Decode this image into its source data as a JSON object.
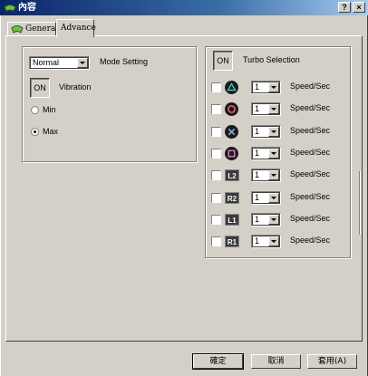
{
  "window": {
    "title": "內容",
    "help_button": "?",
    "close_button": "×"
  },
  "tabs": [
    {
      "label": "General",
      "active": false
    },
    {
      "label": "Advance",
      "active": true
    }
  ],
  "mode": {
    "combo_value": "Normal",
    "label": "Mode Setting"
  },
  "vibration": {
    "toggle_label": "ON",
    "label": "Vibration",
    "options": [
      {
        "label": "Min",
        "checked": false
      },
      {
        "label": "Max",
        "checked": true
      }
    ]
  },
  "turbo": {
    "toggle_label": "ON",
    "label": "Turbo Selection",
    "rows": [
      {
        "button": "triangle",
        "icon_text": "",
        "value": "1",
        "unit": "Speed/Sec",
        "checked": false
      },
      {
        "button": "circle",
        "icon_text": "",
        "value": "1",
        "unit": "Speed/Sec",
        "checked": false
      },
      {
        "button": "cross",
        "icon_text": "",
        "value": "1",
        "unit": "Speed/Sec",
        "checked": false
      },
      {
        "button": "square",
        "icon_text": "",
        "value": "1",
        "unit": "Speed/Sec",
        "checked": false
      },
      {
        "button": "L2",
        "icon_text": "L2",
        "value": "1",
        "unit": "Speed/Sec",
        "checked": false
      },
      {
        "button": "R2",
        "icon_text": "R2",
        "value": "1",
        "unit": "Speed/Sec",
        "checked": false
      },
      {
        "button": "L1",
        "icon_text": "L1",
        "value": "1",
        "unit": "Speed/Sec",
        "checked": false
      },
      {
        "button": "R1",
        "icon_text": "R1",
        "value": "1",
        "unit": "Speed/Sec",
        "checked": false
      }
    ]
  },
  "footer": {
    "ok": "確定",
    "cancel": "取消",
    "apply": "套用(A)"
  },
  "colors": {
    "titlebar_start": "#0a246a",
    "titlebar_end": "#a6caf0",
    "face": "#d4d0c8"
  }
}
